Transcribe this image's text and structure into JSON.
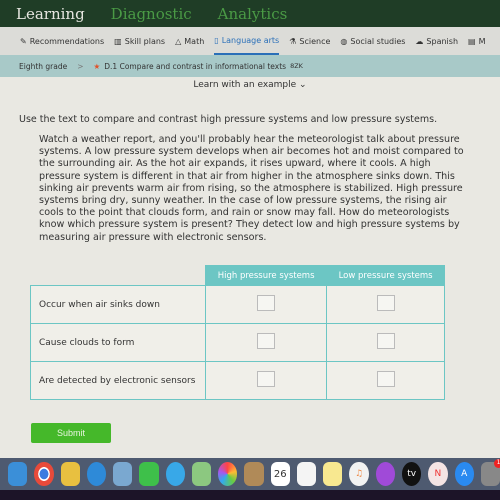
{
  "topnav": {
    "items": [
      "Learning",
      "Diagnostic",
      "Analytics"
    ]
  },
  "subjects": [
    {
      "label": "Recommendations",
      "icon": "recommendations-icon"
    },
    {
      "label": "Skill plans",
      "icon": "skill-plans-icon"
    },
    {
      "label": "Math",
      "icon": "math-icon"
    },
    {
      "label": "Language arts",
      "icon": "language-arts-icon",
      "active": true
    },
    {
      "label": "Science",
      "icon": "science-icon"
    },
    {
      "label": "Social studies",
      "icon": "social-studies-icon"
    },
    {
      "label": "Spanish",
      "icon": "spanish-icon"
    },
    {
      "label": "M",
      "icon": "more-icon"
    }
  ],
  "breadcrumb": {
    "grade": "Eighth grade",
    "separator": ">",
    "skill": "D.1 Compare and contrast in informational texts",
    "code": "8ZK"
  },
  "learn": "Learn with an example ⌄",
  "question": "Use the text to compare and contrast high pressure systems and low pressure systems.",
  "passage": "Watch a weather report, and you'll probably hear the meteorologist talk about pressure systems. A low pressure system develops when air becomes hot and moist compared to the surrounding air. As the hot air expands, it rises upward, where it cools. A high pressure system is different in that air from higher in the atmosphere sinks down. This sinking air prevents warm air from rising, so the atmosphere is stabilized. High pressure systems bring dry, sunny weather. In the case of low pressure systems, the rising air cools to the point that clouds form, and rain or snow may fall. How do meteorologists know which pressure system is present? They detect low and high pressure systems by measuring air pressure with electronic sensors.",
  "table": {
    "headers": [
      "High pressure systems",
      "Low pressure systems"
    ],
    "rows": [
      "Occur when air sinks down",
      "Cause clouds to form",
      "Are detected by electronic sensors"
    ]
  },
  "submit": "Submit",
  "dock": {
    "calendar_day": "26",
    "apps": [
      "finder",
      "chrome",
      "launchpad",
      "safari",
      "preview",
      "facetime",
      "messages",
      "maps",
      "photos",
      "contacts",
      "calendar",
      "reminders",
      "notes",
      "music",
      "podcasts",
      "tv",
      "news",
      "app-store",
      "system-preferences"
    ],
    "tv_label": "tv",
    "badge": "1"
  },
  "colors": {
    "accent": "#45b82a",
    "nav": "#1f3d26",
    "table": "#6cc6c4"
  }
}
